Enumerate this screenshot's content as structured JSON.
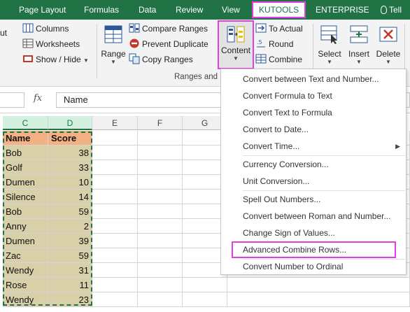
{
  "tabs": [
    {
      "label": "Page Layout"
    },
    {
      "label": "Formulas"
    },
    {
      "label": "Data"
    },
    {
      "label": "Review"
    },
    {
      "label": "View"
    },
    {
      "label": "KUTOOLS"
    },
    {
      "label": "ENTERPRISE"
    },
    {
      "label": "Tell"
    }
  ],
  "ribbon": {
    "partial_label": "ut",
    "columns": "Columns",
    "worksheets": "Worksheets",
    "show_hide": "Show / Hide",
    "range": "Range",
    "compare_ranges": "Compare Ranges",
    "prevent_duplicate": "Prevent Duplicate",
    "copy_ranges": "Copy Ranges",
    "content": "Content",
    "to_actual": "To Actual",
    "round": "Round",
    "combine": "Combine",
    "select": "Select",
    "insert": "Insert",
    "delete": "Delete",
    "group_label": "Ranges and C"
  },
  "formula_bar": {
    "fx": "fx",
    "content": "Name"
  },
  "grid": {
    "columns": [
      "C",
      "D",
      "E",
      "F",
      "G"
    ],
    "header_row": [
      "Name",
      "Score"
    ],
    "rows": [
      [
        "Bob",
        "38"
      ],
      [
        "Golf",
        "33"
      ],
      [
        "Dumen",
        "10"
      ],
      [
        "Silence",
        "14"
      ],
      [
        "Bob",
        "59"
      ],
      [
        "Anny",
        "2"
      ],
      [
        "Dumen",
        "39"
      ],
      [
        "Zac",
        "59"
      ],
      [
        "Wendy",
        "31"
      ],
      [
        "Rose",
        "11"
      ],
      [
        "Wendy",
        "23"
      ]
    ]
  },
  "menu": {
    "items": [
      "Convert between Text and Number...",
      "Convert Formula to Text",
      "Convert Text to Formula",
      "Convert to Date...",
      "Convert Time...",
      "Currency Conversion...",
      "Unit Conversion...",
      "Spell Out Numbers...",
      "Convert between Roman and Number...",
      "Change Sign of Values...",
      "Advanced Combine Rows...",
      "Convert Number to Ordinal"
    ]
  },
  "colors": {
    "excel_green": "#217346",
    "highlight": "#e040e0",
    "header_fill": "#f4b183",
    "data_fill": "#d9cfa8"
  }
}
